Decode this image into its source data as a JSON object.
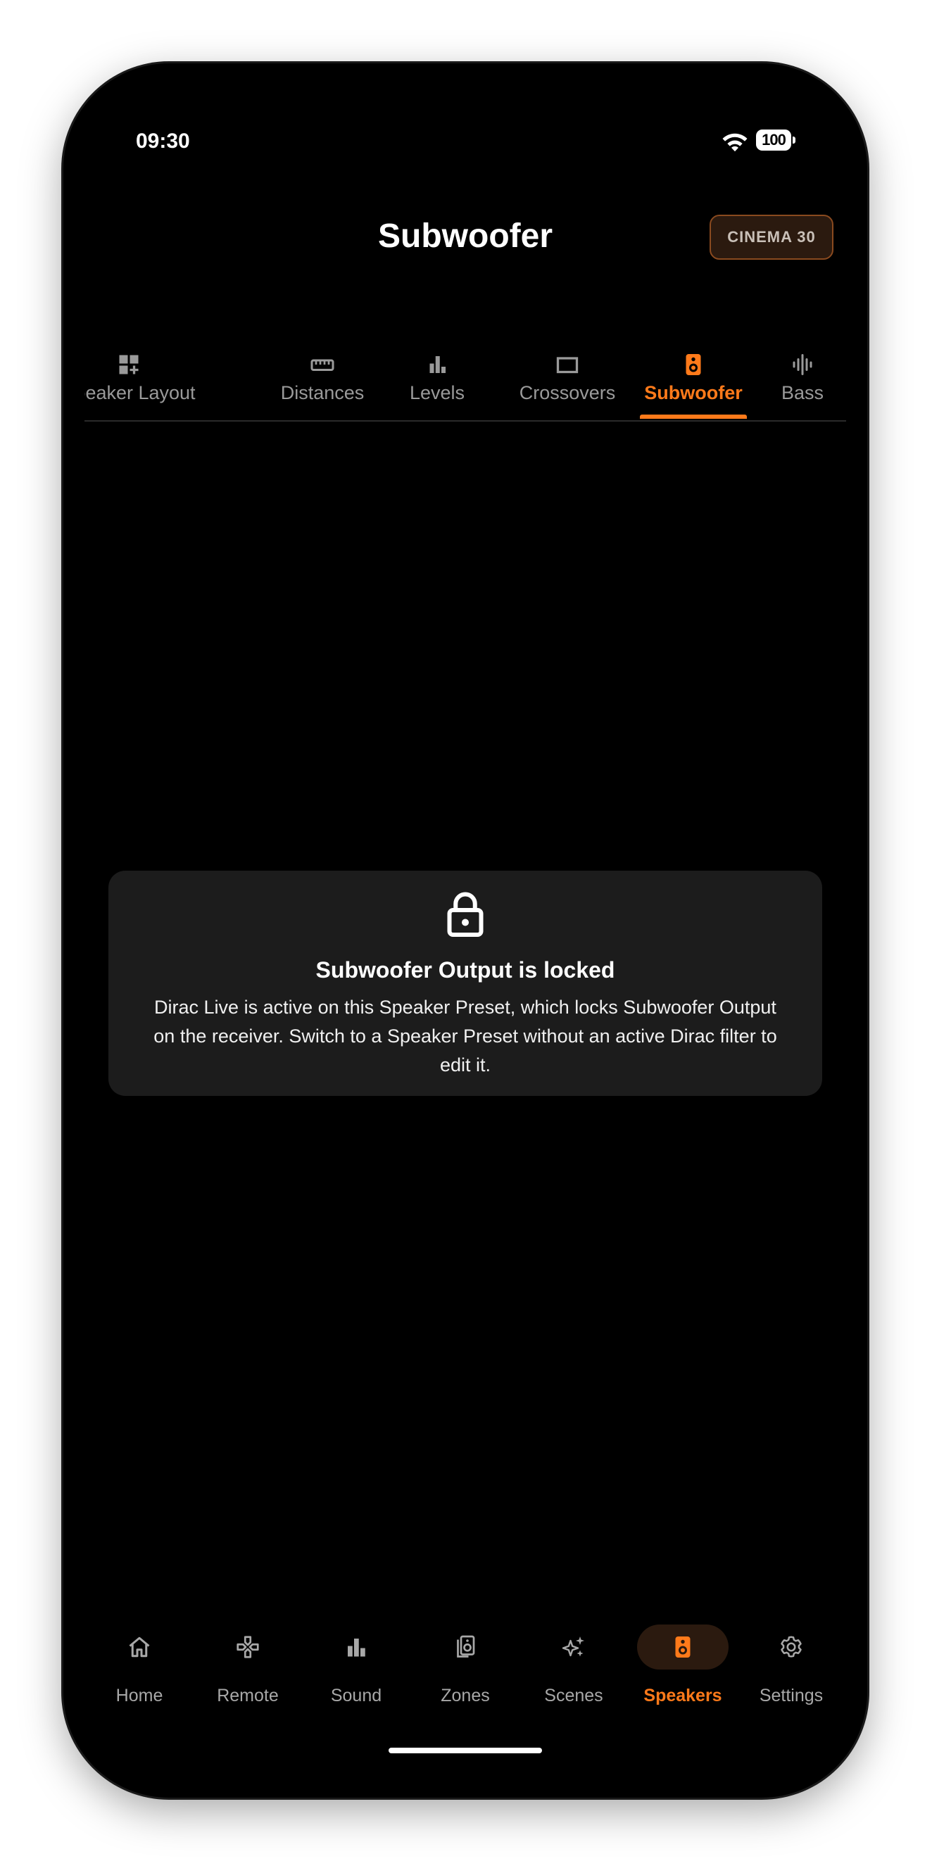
{
  "status_bar": {
    "time": "09:30",
    "battery": "100"
  },
  "header": {
    "title": "Subwoofer",
    "preset": "CINEMA 30"
  },
  "tabs": [
    {
      "label": "Speaker Layout",
      "icon": "grid-plus-icon"
    },
    {
      "label": "Distances",
      "icon": "ruler-icon"
    },
    {
      "label": "Levels",
      "icon": "bar-chart-icon"
    },
    {
      "label": "Crossovers",
      "icon": "crop-rectangle-icon"
    },
    {
      "label": "Subwoofer",
      "icon": "speaker-icon",
      "active": true
    },
    {
      "label": "Bass",
      "icon": "waveform-icon"
    }
  ],
  "lock_card": {
    "icon": "lock-icon",
    "title": "Subwoofer Output is locked",
    "body": "Dirac Live is active on this Speaker Preset, which locks Subwoofer Output on the receiver. Switch to a Speaker Preset without an active Dirac filter to edit it."
  },
  "bottom_nav": [
    {
      "label": "Home",
      "icon": "home-icon"
    },
    {
      "label": "Remote",
      "icon": "gamepad-icon"
    },
    {
      "label": "Sound",
      "icon": "bar-chart-icon"
    },
    {
      "label": "Zones",
      "icon": "speaker-group-icon"
    },
    {
      "label": "Scenes",
      "icon": "sparkles-icon"
    },
    {
      "label": "Speakers",
      "icon": "speaker-icon",
      "active": true
    },
    {
      "label": "Settings",
      "icon": "gear-icon"
    }
  ],
  "colors": {
    "accent": "#ff7a1a",
    "background": "#000000",
    "card": "#1c1c1c",
    "inactive": "#9a9a9a"
  }
}
